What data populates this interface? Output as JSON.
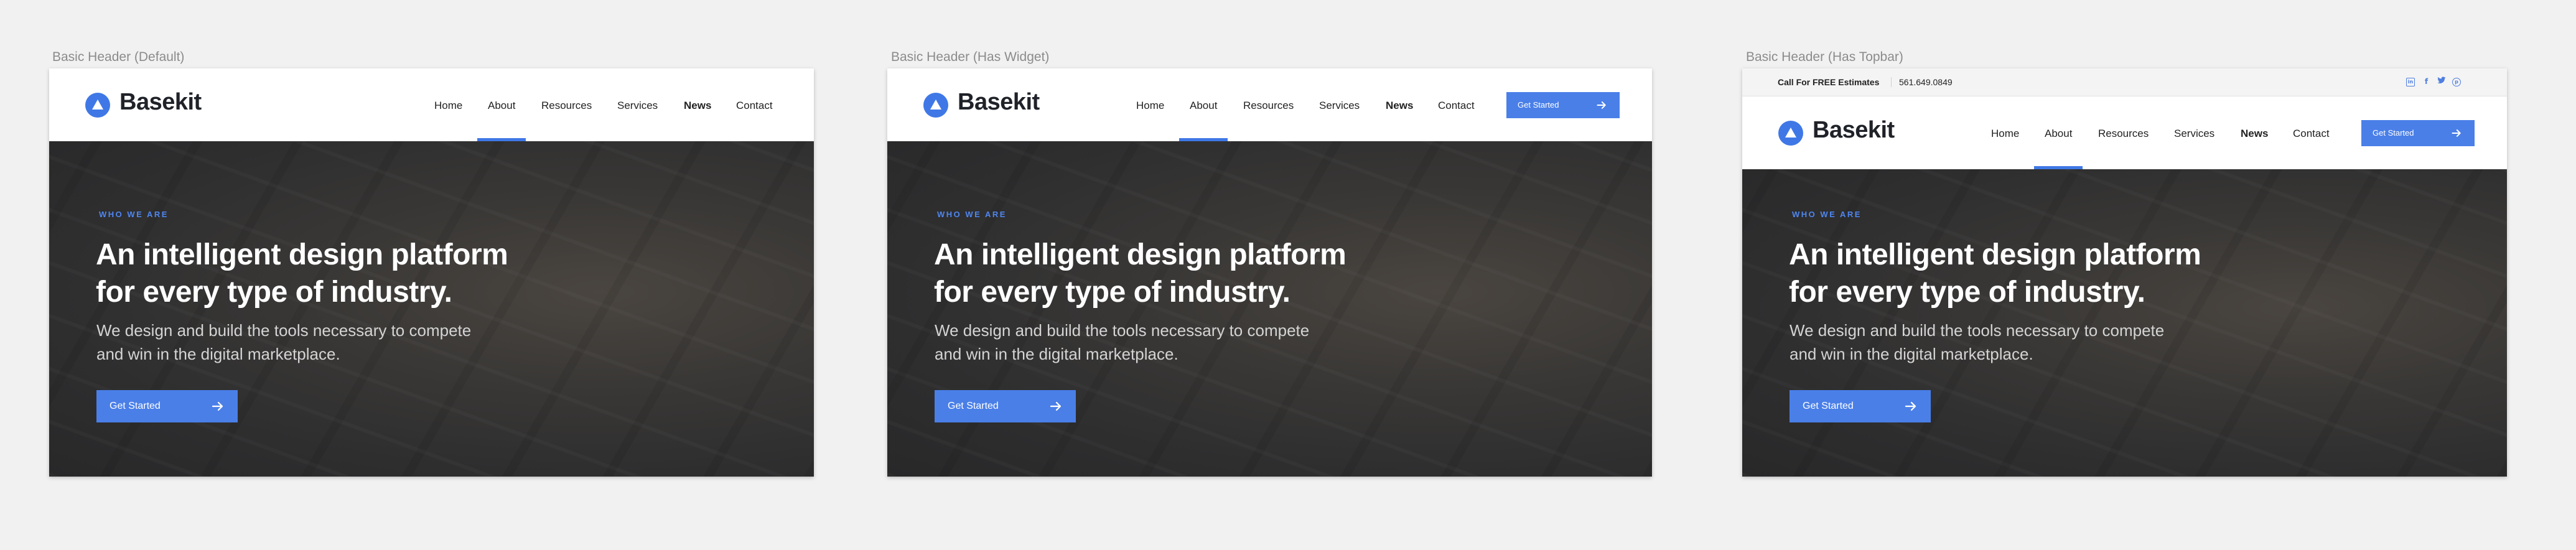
{
  "colors": {
    "accent": "#4a7fe8",
    "canvas_bg": "#f1f1f1",
    "hero_bg": "#2b2b2b",
    "label_gray": "#8b8b8b"
  },
  "artboards": [
    {
      "label": "Basic Header (Default)",
      "brand": "Basekit",
      "nav": [
        "Home",
        "About",
        "Resources",
        "Services",
        "News",
        "Contact"
      ],
      "active_nav": "About",
      "eyebrow": "WHO WE ARE",
      "headline_line1": "An intelligent design platform",
      "headline_line2": "for every type of industry.",
      "sub_line1": "We design and build the tools necessary to compete",
      "sub_line2": "and win in the digital marketplace.",
      "cta_label": "Get Started"
    },
    {
      "label": "Basic Header (Has Widget)",
      "brand": "Basekit",
      "nav": [
        "Home",
        "About",
        "Resources",
        "Services",
        "News",
        "Contact"
      ],
      "active_nav": "About",
      "nav_cta_label": "Get Started",
      "eyebrow": "WHO WE ARE",
      "headline_line1": "An intelligent design platform",
      "headline_line2": "for every type of industry.",
      "sub_line1": "We design and build the tools necessary to compete",
      "sub_line2": "and win in the digital marketplace.",
      "cta_label": "Get Started"
    },
    {
      "label": "Basic Header (Has Topbar)",
      "topbar": {
        "call_label": "Call For FREE Estimates",
        "phone": "561.649.0849",
        "social_icons": [
          "linkedin-icon",
          "facebook-icon",
          "twitter-icon",
          "pinterest-icon"
        ]
      },
      "brand": "Basekit",
      "nav": [
        "Home",
        "About",
        "Resources",
        "Services",
        "News",
        "Contact"
      ],
      "active_nav": "About",
      "nav_cta_label": "Get Started",
      "eyebrow": "WHO WE ARE",
      "headline_line1": "An intelligent design platform",
      "headline_line2": "for every type of industry.",
      "sub_line1": "We design and build the tools necessary to compete",
      "sub_line2": "and win in the digital marketplace.",
      "cta_label": "Get Started"
    }
  ]
}
